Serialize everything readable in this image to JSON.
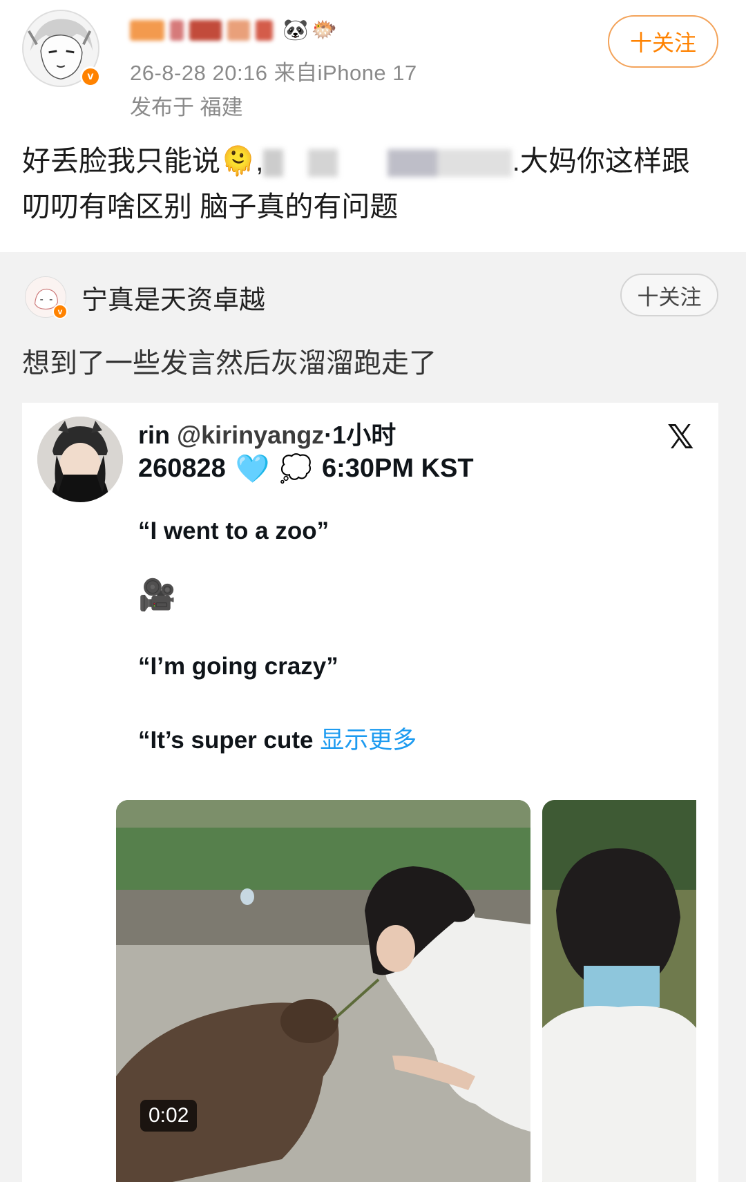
{
  "post": {
    "meta": "26-8-28 20:16  来自iPhone 17",
    "location": "发布于 福建",
    "follow_label": "十关注",
    "text_start": "好丢脸我只能说",
    "emoji": "🫠",
    "text_mid": ",",
    "text_end": ".大妈你这样跟叨叨有啥区别 脑子真的有问题",
    "username_emojis": [
      "🐼",
      "🐡"
    ]
  },
  "repost": {
    "user_name": "宁真是天资卓越",
    "follow_label": "十关注",
    "text": "想到了一些发言然后灰溜溜跑走了"
  },
  "tweet": {
    "name": "rin",
    "handle": "@kirinyangz",
    "time": "·1小时",
    "date_code": "260828",
    "heart_emoji": "🩵",
    "thought_emoji": "💭",
    "time_kst": "6:30PM KST",
    "x_logo": "𝕏",
    "line1": "“I went to a zoo”",
    "camera_emoji": "🎥",
    "line2": "“I’m going crazy”",
    "line3": "“It’s super cute ",
    "show_more": "显示更多",
    "video_duration": "0:02"
  }
}
